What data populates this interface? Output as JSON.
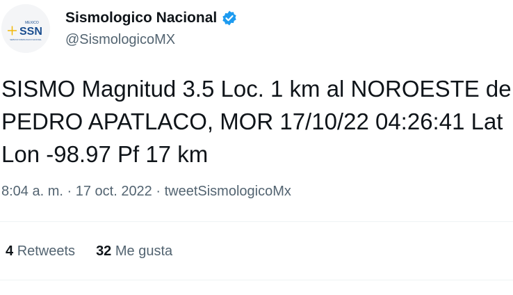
{
  "author": {
    "avatar_text": "SSN",
    "avatar_small": "MEXICO",
    "avatar_caption": "SERVICIO SISMOLOGICO NACIONAL",
    "display_name": "Sismologico Nacional",
    "handle": "@SismologicoMX",
    "verified_icon": "verified-badge-icon",
    "brand_color": "#1a4d8f",
    "accent_color": "#f2b705"
  },
  "tweet": {
    "lines": [
      "SISMO Magnitud 3.5 Loc. 1 km al NOROESTE de",
      "PEDRO APATLACO, MOR 17/10/22 04:26:41 Lat",
      "Lon -98.97 Pf 17 km"
    ]
  },
  "meta": {
    "time": "8:04 a. m.",
    "date": "17 oct. 2022",
    "source": "tweetSismologicoMx"
  },
  "stats": {
    "retweets_count": "4",
    "retweets_label": "Retweets",
    "likes_count": "32",
    "likes_label": "Me gusta"
  },
  "colors": {
    "text": "#0f1419",
    "secondary": "#536471",
    "verified": "#1d9bf0",
    "divider": "#eff3f4"
  }
}
